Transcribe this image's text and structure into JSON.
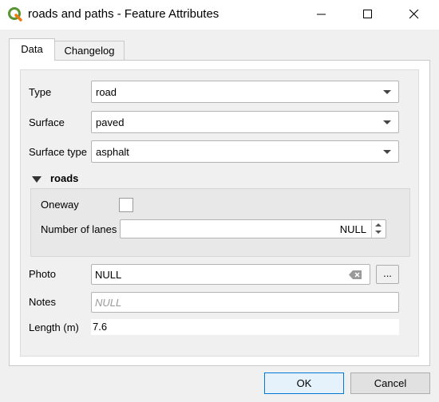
{
  "window": {
    "title": "roads and paths - Feature Attributes",
    "app_icon": "qgis-icon",
    "controls": [
      "minimize-icon",
      "maximize-icon",
      "close-icon"
    ]
  },
  "tabs": [
    {
      "label": "Data",
      "selected": true
    },
    {
      "label": "Changelog",
      "selected": false
    }
  ],
  "form": {
    "type": {
      "label": "Type",
      "value": "road"
    },
    "surface": {
      "label": "Surface",
      "value": "paved"
    },
    "surface_type": {
      "label": "Surface type",
      "value": "asphalt"
    },
    "roads_section": {
      "title": "roads",
      "expanded": true,
      "oneway": {
        "label": "Oneway",
        "checked": false
      },
      "lanes": {
        "label": "Number of lanes",
        "value": "NULL"
      }
    },
    "photo": {
      "label": "Photo",
      "value": "NULL",
      "browse_label": "..."
    },
    "notes": {
      "label": "Notes",
      "placeholder": "NULL"
    },
    "length": {
      "label": "Length (m)",
      "value": "7.6"
    }
  },
  "buttons": {
    "ok": "OK",
    "cancel": "Cancel"
  },
  "colors": {
    "accent": "#0078d7",
    "qgis_green": "#589632",
    "qgis_yellow": "#ee7913"
  }
}
